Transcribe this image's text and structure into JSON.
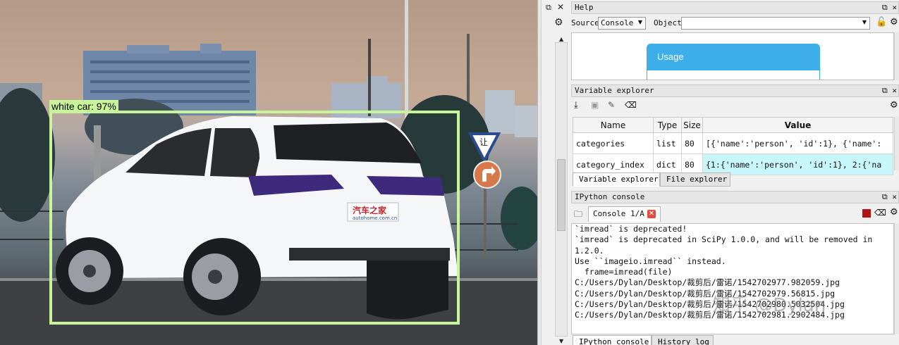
{
  "detection": {
    "label": "white car: 97%",
    "box_color": "#c8f59a",
    "plate_text": "汽车之家",
    "plate_url": "autohome.com.cn",
    "sign_icon": "turn-right-sign-icon",
    "yield_text": "让"
  },
  "help": {
    "title": "Help",
    "source_label": "Source",
    "source_value": "Console",
    "object_label": "Object",
    "object_value": "",
    "usage_title": "Usage",
    "usage_color": "#3daee9"
  },
  "variable_explorer": {
    "title": "Variable explorer",
    "columns": [
      "Name",
      "Type",
      "Size",
      "Value"
    ],
    "rows": [
      {
        "name": "categories",
        "type": "list",
        "size": "80",
        "value": "[{'name':'person', 'id':1}, {'name':"
      },
      {
        "name": "category_index",
        "type": "dict",
        "size": "80",
        "value": "{1:{'name':'person', 'id':1}, 2:{'na"
      }
    ],
    "dict_color": "#c8f7fb",
    "tabs": [
      "Variable explorer",
      "File explorer"
    ]
  },
  "ipython": {
    "title": "IPython console",
    "console_tab": "Console 1/A",
    "lines": [
      "`imread` is deprecated!",
      "`imread` is deprecated in SciPy 1.0.0, and will be removed in",
      "1.2.0.",
      "Use ``imageio.imread`` instead.",
      "  frame=imread(file)",
      "C:/Users/Dylan/Desktop/裁剪后/雷诺/1542702977.982059.jpg",
      "C:/Users/Dylan/Desktop/裁剪后/雷诺/1542702979.56815.jpg",
      "C:/Users/Dylan/Desktop/裁剪后/雷诺/1542702980.5032504.jpg",
      "C:/Users/Dylan/Desktop/裁剪后/雷诺/1542702981.2902484.jpg"
    ],
    "bottom_tabs": [
      "IPython console",
      "History log"
    ],
    "watermark": "知乎 @Dylan"
  }
}
